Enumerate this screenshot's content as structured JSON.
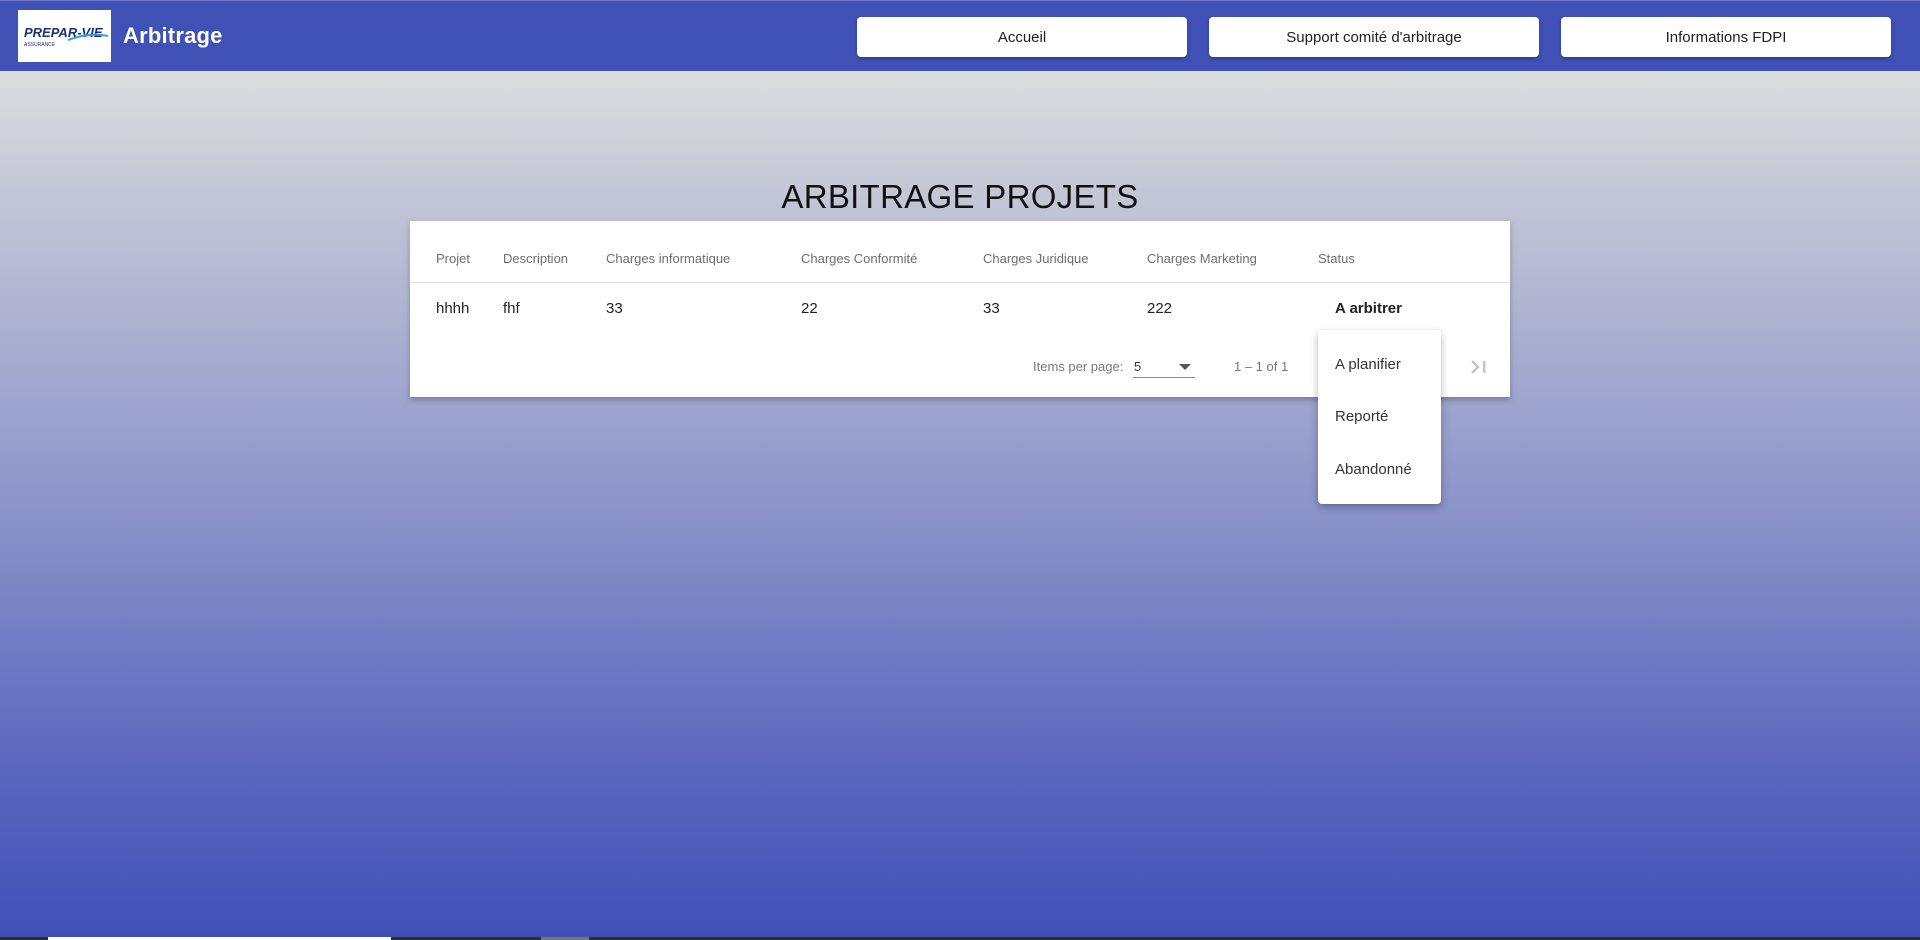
{
  "header": {
    "logo_text": "PREPAR-VIE",
    "logo_subtext": "ASSURANCE",
    "app_title": "Arbitrage",
    "nav": [
      {
        "label": "Accueil"
      },
      {
        "label": "Support comité d'arbitrage"
      },
      {
        "label": "Informations FDPI"
      }
    ],
    "colors": {
      "primary": "#3f51b5"
    }
  },
  "page": {
    "title": "ARBITRAGE PROJETS"
  },
  "table": {
    "columns": [
      "Projet",
      "Description",
      "Charges informatique",
      "Charges Conformité",
      "Charges Juridique",
      "Charges Marketing",
      "Status"
    ],
    "rows": [
      {
        "projet": "hhhh",
        "description": "fhf",
        "charges_informatique": "33",
        "charges_conformite": "22",
        "charges_juridique": "33",
        "charges_marketing": "222",
        "status": "A arbitrer"
      }
    ]
  },
  "paginator": {
    "items_per_page_label": "Items per page:",
    "page_size": "5",
    "range_label": "1 – 1 of 1",
    "last_page_icon": "last-page-icon"
  },
  "status_menu": {
    "options": [
      "A planifier",
      "Reporté",
      "Abandonné"
    ]
  }
}
